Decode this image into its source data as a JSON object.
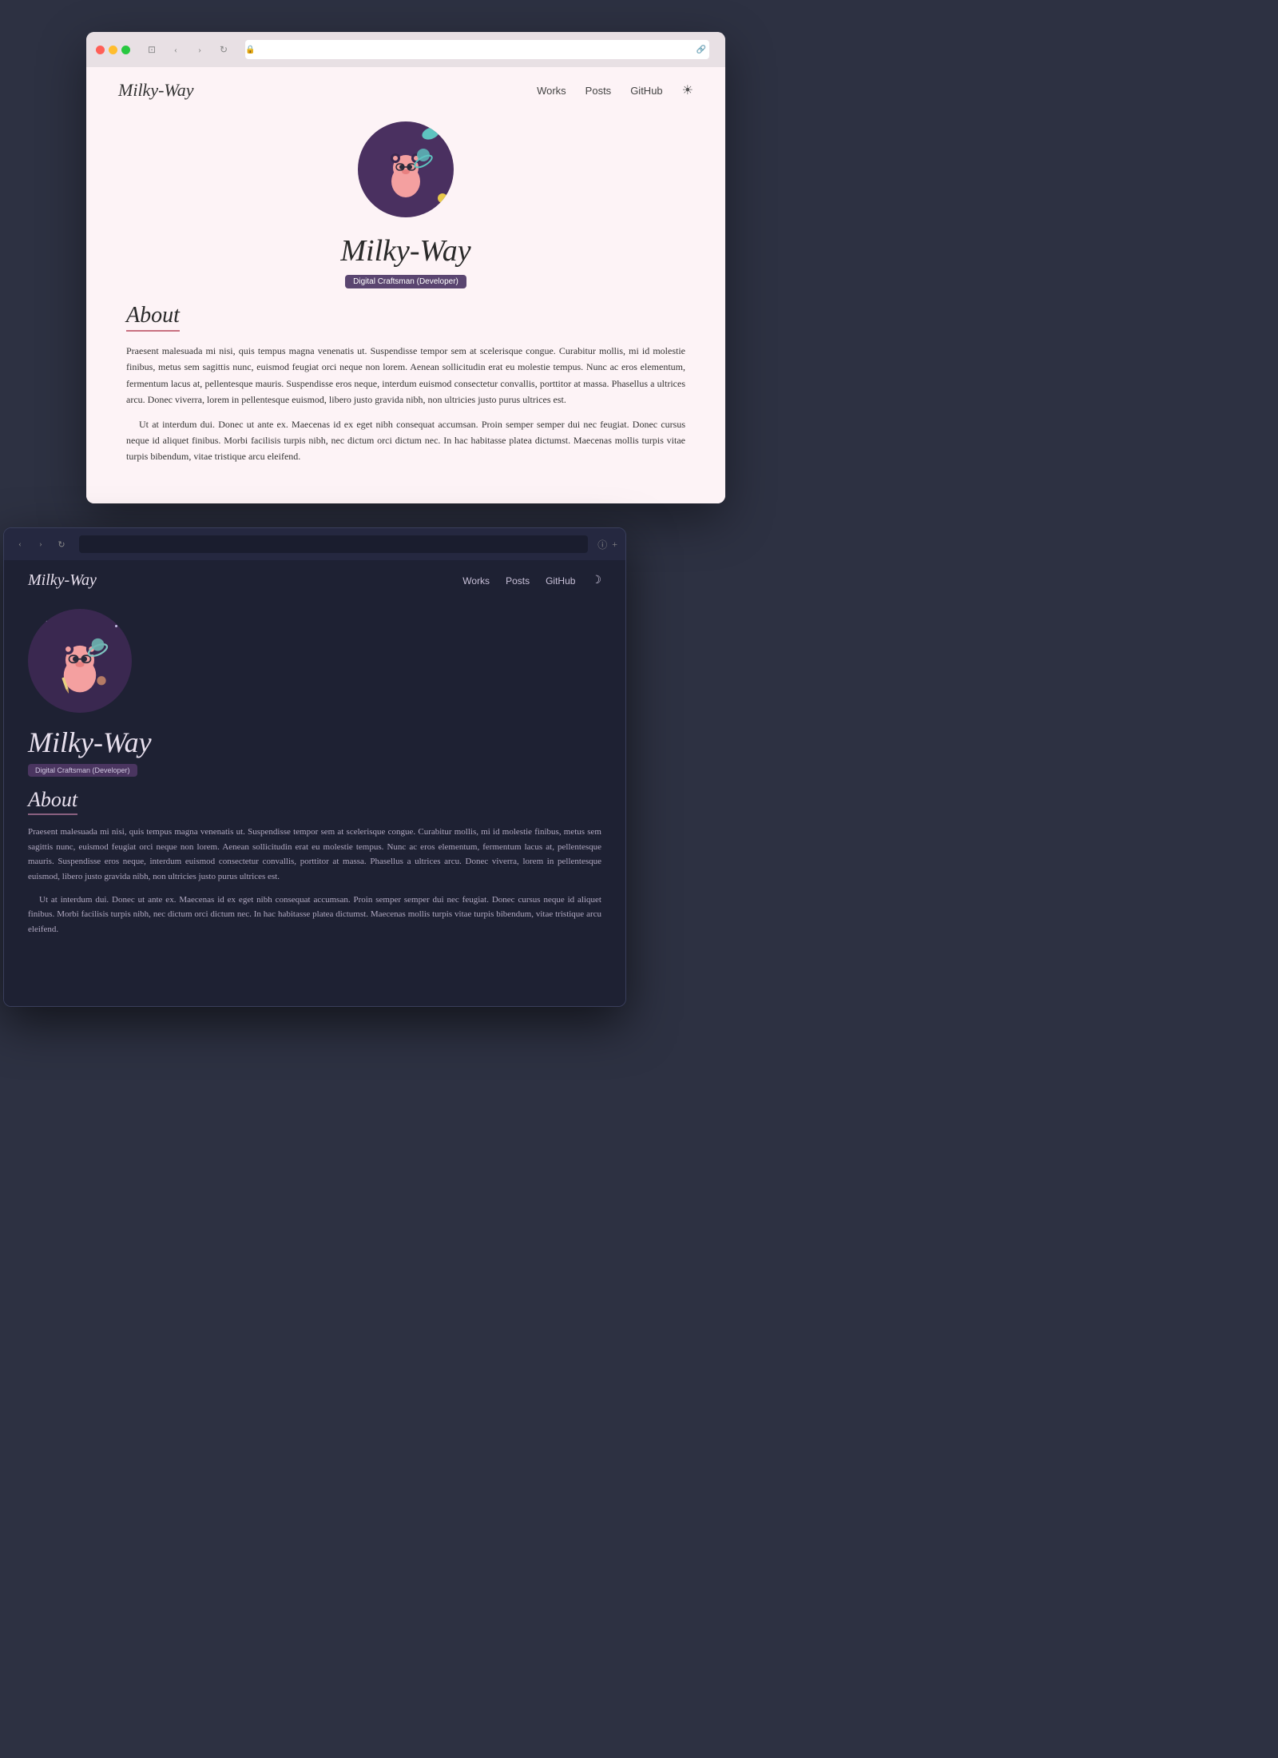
{
  "light_browser": {
    "nav": {
      "brand": "Milky-Way",
      "links": [
        "Works",
        "Posts",
        "GitHub"
      ],
      "theme_icon": "☀"
    },
    "hero": {
      "title": "Milky-Way",
      "badge": "Digital Craftsman (Developer)"
    },
    "about": {
      "heading": "About",
      "paragraph1": "Praesent malesuada mi nisi, quis tempus magna venenatis ut. Suspendisse tempor sem at scelerisque congue. Curabitur mollis, mi id molestie finibus, metus sem sagittis nunc, euismod feugiat orci neque non lorem. Aenean sollicitudin erat eu molestie tempus. Nunc ac eros elementum, fermentum lacus at, pellentesque mauris. Suspendisse eros neque, interdum euismod consectetur convallis, porttitor at massa. Phasellus a ultrices arcu. Donec viverra, lorem in pellentesque euismod, libero justo gravida nibh, non ultricies justo purus ultrices est.",
      "paragraph2": "Ut at interdum dui. Donec ut ante ex. Maecenas id ex eget nibh consequat accumsan. Proin semper semper dui nec feugiat. Donec cursus neque id aliquet finibus. Morbi facilisis turpis nibh, nec dictum orci dictum nec. In hac habitasse platea dictumst. Maecenas mollis turpis vitae turpis bibendum, vitae tristique arcu eleifend."
    },
    "address_bar": {
      "lock": "🔒",
      "url": "",
      "link_icon": "🔗"
    }
  },
  "dark_browser": {
    "nav": {
      "brand": "Milky-Way",
      "links": [
        "Works",
        "Posts",
        "GitHub"
      ],
      "theme_icon": ")"
    },
    "hero": {
      "title": "Milky-Way",
      "badge": "Digital Craftsman (Developer)"
    },
    "about": {
      "heading": "About",
      "paragraph1": "Praesent malesuada mi nisi, quis tempus magna venenatis ut. Suspendisse tempor sem at scelerisque congue. Curabitur mollis, mi id molestie finibus, metus sem sagittis nunc, euismod feugiat orci neque non lorem. Aenean sollicitudin erat eu molestie tempus. Nunc ac eros elementum, fermentum lacus at, pellentesque mauris. Suspendisse eros neque, interdum euismod consectetur convallis, porttitor at massa. Phasellus a ultrices arcu. Donec viverra, lorem in pellentesque euismod, libero justo gravida nibh, non ultricies justo purus ultrices est.",
      "paragraph2": "Ut at interdum dui. Donec ut ante ex. Maecenas id ex eget nibh consequat accumsan. Proin semper semper dui nec feugiat. Donec cursus neque id aliquet finibus. Morbi facilisis turpis nibh, nec dictum orci dictum nec. In hac habitasse platea dictumst. Maecenas mollis turpis vitae turpis bibendum, vitae tristique arcu eleifend."
    }
  }
}
